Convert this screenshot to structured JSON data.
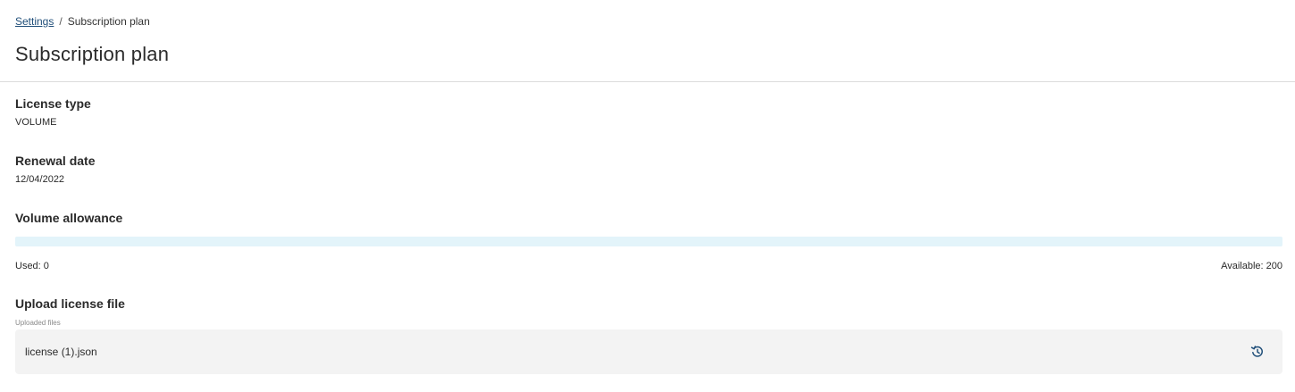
{
  "breadcrumb": {
    "parent_label": "Settings",
    "separator": "/",
    "current_label": "Subscription plan"
  },
  "page_title": "Subscription plan",
  "license_type": {
    "label": "License type",
    "value": "VOLUME"
  },
  "renewal_date": {
    "label": "Renewal date",
    "value": "12/04/2022"
  },
  "volume_allowance": {
    "label": "Volume allowance",
    "used_text": "Used: 0",
    "available_text": "Available: 200",
    "used": 0,
    "available": 200,
    "fill_fraction": 0
  },
  "upload": {
    "label": "Upload license file",
    "caption": "Uploaded files",
    "files": [
      {
        "name": "license (1).json",
        "action_icon": "restore-icon"
      }
    ]
  },
  "colors": {
    "link": "#1f4e79",
    "progress_track": "#e3f4fa",
    "file_row_bg": "#f3f3f3",
    "icon": "#1f4e79"
  }
}
